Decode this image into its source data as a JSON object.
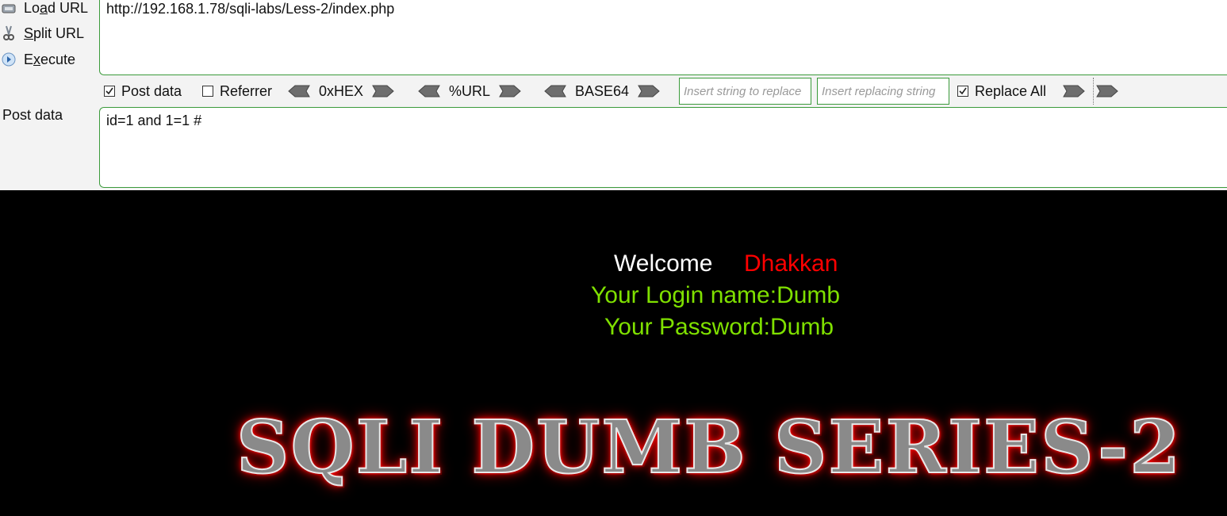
{
  "hackbar": {
    "buttons": {
      "load_url": "Load URL",
      "split_url": "Split URL",
      "execute": "Execute"
    },
    "url_value": "http://192.168.1.78/sqli-labs/Less-2/index.php",
    "toolbar": {
      "post_data_label": "Post data",
      "post_data_checked": true,
      "referrer_label": "Referrer",
      "referrer_checked": false,
      "hex_label": "0xHEX",
      "url_label": "%URL",
      "base64_label": "BASE64",
      "replace_find_placeholder": "Insert string to replace",
      "replace_with_placeholder": "Insert replacing string",
      "replace_all_label": "Replace All",
      "replace_all_checked": true
    },
    "post_label": "Post data",
    "post_value": "id=1 and 1=1 #"
  },
  "page": {
    "welcome": "Welcome",
    "username": "Dhakkan",
    "login_line": "Your Login name:Dumb",
    "password_line": "Your Password:Dumb",
    "banner": "SQLI DUMB SERIES-2"
  },
  "colors": {
    "background": "#000000",
    "welcome": "#ffffff",
    "username": "#ff0000",
    "info": "#7fe000",
    "border_accent": "#3a9a3a"
  }
}
